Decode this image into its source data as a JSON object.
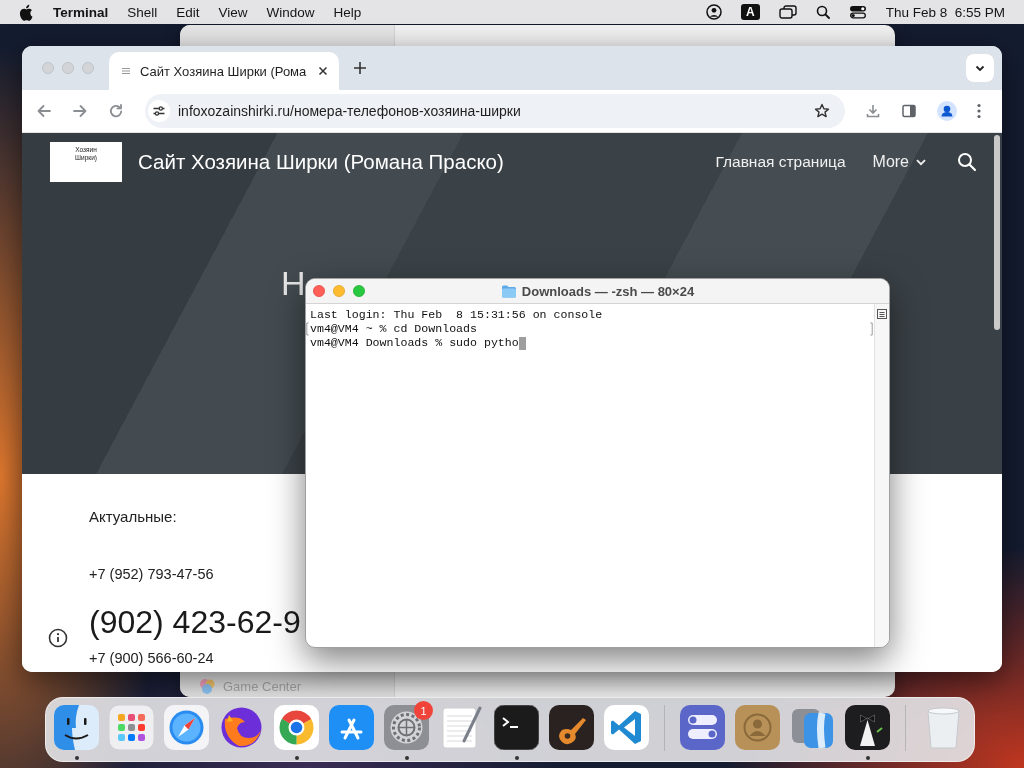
{
  "menu_bar": {
    "app_name": "Terminal",
    "menus": [
      "Shell",
      "Edit",
      "View",
      "Window",
      "Help"
    ],
    "input_source": "A",
    "clock": "Thu Feb 8  6:55 PM"
  },
  "background_window": {
    "sidebar_item": "Game Center"
  },
  "browser": {
    "tabs": [
      {
        "title": "Сайт Хозяина Ширки (Рома",
        "selected": true
      }
    ],
    "address": "infoxozainshirki.ru/номера-телефонов-хозяина-ширки",
    "page": {
      "logo_text": "Хозяин Ширки)",
      "site_title": "Сайт Хозяина Ширки (Романа Праско)",
      "nav": [
        {
          "label": "Главная страница",
          "kind": "link"
        },
        {
          "label": "More",
          "kind": "dropdown"
        }
      ],
      "heading": "Н",
      "section_label": "Актуальные:",
      "phone_1": "+7 (952) 793-47-56",
      "phone_big": "(902) 423-62-9",
      "phone_2": "+7 (900) 566-60-24"
    }
  },
  "terminal": {
    "title": "Downloads — -zsh — 80×24",
    "lines": [
      {
        "text": "Last login: Thu Feb  8 15:31:56 on console",
        "marked": false,
        "cursor": false
      },
      {
        "text": "vm4@VM4 ~ % cd Downloads",
        "marked": true,
        "cursor": false
      },
      {
        "text": "vm4@VM4 Downloads % sudo pytho",
        "marked": false,
        "cursor": true
      }
    ]
  },
  "dock": {
    "items": [
      {
        "kind": "face",
        "running": true
      },
      {
        "kind": "grid",
        "running": false
      },
      {
        "kind": "compass",
        "running": false
      },
      {
        "kind": "fox",
        "running": false
      },
      {
        "kind": "ring",
        "running": true
      },
      {
        "kind": "letter",
        "running": false
      },
      {
        "kind": "gear",
        "running": true,
        "badge": "1"
      },
      {
        "kind": "notepad",
        "running": false
      },
      {
        "kind": "prompt",
        "running": true
      },
      {
        "kind": "guitar",
        "running": false
      },
      {
        "kind": "ribbon",
        "running": false
      },
      {
        "kind": "separator"
      },
      {
        "kind": "toggles",
        "running": false
      },
      {
        "kind": "portrait",
        "running": false
      },
      {
        "kind": "faces",
        "running": false
      },
      {
        "kind": "tuxedo",
        "running": true
      },
      {
        "kind": "separator"
      },
      {
        "kind": "bin",
        "running": false
      }
    ]
  }
}
